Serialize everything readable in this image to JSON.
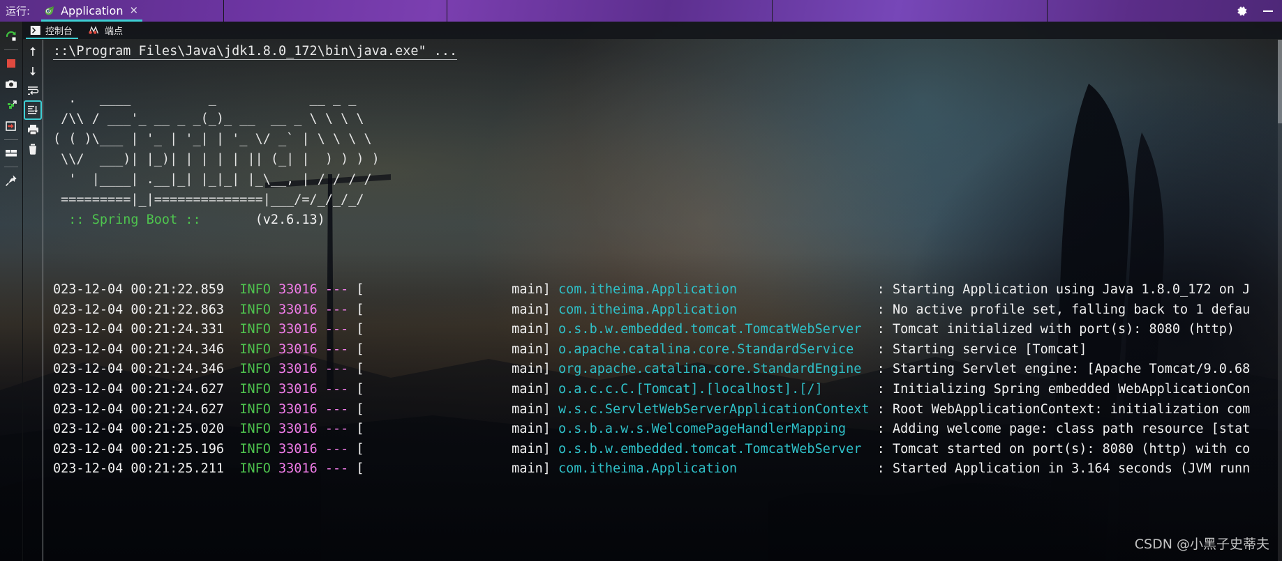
{
  "window": {
    "run_label": "运行:",
    "tab_title": "Application",
    "tab_close": "✕",
    "settings_icon": "gear-icon",
    "minimize_icon": "minimize-icon"
  },
  "console_tabs": [
    {
      "label": "控制台",
      "icon": "console-icon",
      "active": true
    },
    {
      "label": "端点",
      "icon": "endpoints-icon",
      "active": false
    }
  ],
  "left_toolbar": [
    {
      "name": "rerun-button",
      "icon": "rerun-icon"
    },
    {
      "name": "stop-button",
      "icon": "stop-square-icon"
    },
    {
      "name": "screenshot-button",
      "icon": "camera-icon"
    },
    {
      "name": "attach-debugger-button",
      "icon": "debugger-icon"
    },
    {
      "name": "exit-button",
      "icon": "exit-arrow-icon"
    },
    {
      "name": "layout-button",
      "icon": "layout-icon"
    },
    {
      "name": "pin-button",
      "icon": "pin-icon"
    }
  ],
  "console_toolbar": [
    {
      "name": "scroll-up-button",
      "icon": "arrow-up-icon"
    },
    {
      "name": "scroll-down-button",
      "icon": "arrow-down-icon"
    },
    {
      "name": "soft-wrap-button",
      "icon": "soft-wrap-icon"
    },
    {
      "name": "scroll-to-end-button",
      "icon": "scroll-to-end-icon",
      "selected": true
    },
    {
      "name": "print-button",
      "icon": "printer-icon"
    },
    {
      "name": "clear-all-button",
      "icon": "trash-icon"
    }
  ],
  "console": {
    "command_line": "::\\Program Files\\Java\\jdk1.8.0_172\\bin\\java.exe\" ...",
    "banner": [
      "  .   ____          _            __ _ _",
      " /\\\\ / ___'_ __ _ _(_)_ __  __ _ \\ \\ \\ \\",
      "( ( )\\___ | '_ | '_| | '_ \\/ _` | \\ \\ \\ \\",
      " \\\\/  ___)| |_)| | | | | || (_| |  ) ) ) )",
      "  '  |____| .__|_| |_|_| |_\\__, | / / / /",
      " =========|_|==============|___/=/_/_/_/"
    ],
    "boot_line": "  :: Spring Boot ::",
    "boot_version": "       (v2.6.13)",
    "logs": [
      {
        "timestamp": "023-12-04 00:21:22.859",
        "level": "INFO",
        "pid": "33016",
        "sep": "---",
        "thread": "main",
        "logger": "com.itheima.Application",
        "message": "Starting Application using Java 1.8.0_172 on J"
      },
      {
        "timestamp": "023-12-04 00:21:22.863",
        "level": "INFO",
        "pid": "33016",
        "sep": "---",
        "thread": "main",
        "logger": "com.itheima.Application",
        "message": "No active profile set, falling back to 1 defau"
      },
      {
        "timestamp": "023-12-04 00:21:24.331",
        "level": "INFO",
        "pid": "33016",
        "sep": "---",
        "thread": "main",
        "logger": "o.s.b.w.embedded.tomcat.TomcatWebServer",
        "message": "Tomcat initialized with port(s): 8080 (http)"
      },
      {
        "timestamp": "023-12-04 00:21:24.346",
        "level": "INFO",
        "pid": "33016",
        "sep": "---",
        "thread": "main",
        "logger": "o.apache.catalina.core.StandardService",
        "message": "Starting service [Tomcat]"
      },
      {
        "timestamp": "023-12-04 00:21:24.346",
        "level": "INFO",
        "pid": "33016",
        "sep": "---",
        "thread": "main",
        "logger": "org.apache.catalina.core.StandardEngine",
        "message": "Starting Servlet engine: [Apache Tomcat/9.0.68"
      },
      {
        "timestamp": "023-12-04 00:21:24.627",
        "level": "INFO",
        "pid": "33016",
        "sep": "---",
        "thread": "main",
        "logger": "o.a.c.c.C.[Tomcat].[localhost].[/]",
        "message": "Initializing Spring embedded WebApplicationCon"
      },
      {
        "timestamp": "023-12-04 00:21:24.627",
        "level": "INFO",
        "pid": "33016",
        "sep": "---",
        "thread": "main",
        "logger": "w.s.c.ServletWebServerApplicationContext",
        "message": "Root WebApplicationContext: initialization com"
      },
      {
        "timestamp": "023-12-04 00:21:25.020",
        "level": "INFO",
        "pid": "33016",
        "sep": "---",
        "thread": "main",
        "logger": "o.s.b.a.w.s.WelcomePageHandlerMapping",
        "message": "Adding welcome page: class path resource [stat"
      },
      {
        "timestamp": "023-12-04 00:21:25.196",
        "level": "INFO",
        "pid": "33016",
        "sep": "---",
        "thread": "main",
        "logger": "o.s.b.w.embedded.tomcat.TomcatWebServer",
        "message": "Tomcat started on port(s): 8080 (http) with co"
      },
      {
        "timestamp": "023-12-04 00:21:25.211",
        "level": "INFO",
        "pid": "33016",
        "sep": "---",
        "thread": "main",
        "logger": "com.itheima.Application",
        "message": "Started Application in 3.164 seconds (JVM runn"
      }
    ]
  },
  "watermark": "CSDN @小黑子史蒂夫",
  "colors": {
    "accent": "#3ecfd4",
    "level_info": "#4ec44e",
    "pid": "#f07ce8",
    "logger": "#2fc0c8",
    "message": "#f0f0f0",
    "titlebar": "#6b34a0"
  }
}
